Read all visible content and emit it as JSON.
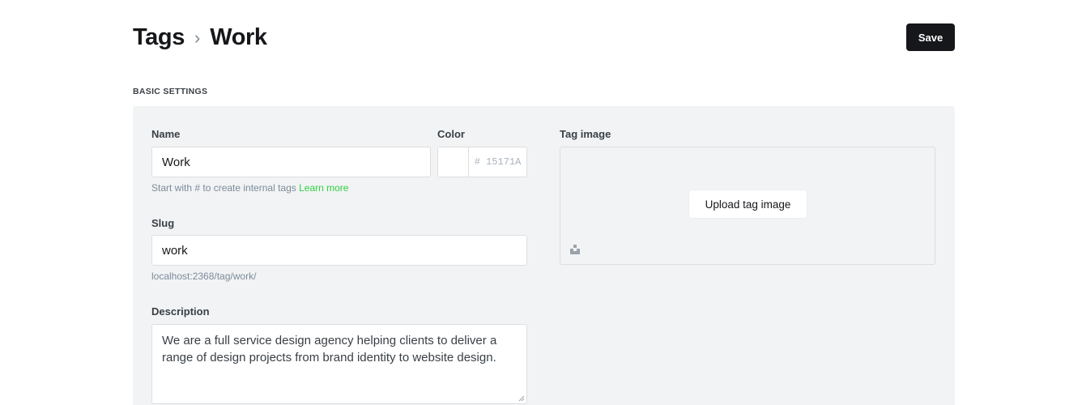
{
  "header": {
    "breadcrumb_parent": "Tags",
    "breadcrumb_separator": "›",
    "breadcrumb_current": "Work",
    "save_label": "Save"
  },
  "section": {
    "title": "BASIC SETTINGS"
  },
  "form": {
    "name": {
      "label": "Name",
      "value": "Work",
      "hint": "Start with # to create internal tags",
      "hint_link": "Learn more"
    },
    "color": {
      "label": "Color",
      "hex_placeholder": "# 15171A"
    },
    "slug": {
      "label": "Slug",
      "value": "work",
      "hint": "localhost:2368/tag/work/"
    },
    "description": {
      "label": "Description",
      "value": "We are a full service design agency helping clients to deliver a range of design projects from brand identity to website design."
    },
    "tag_image": {
      "label": "Tag image",
      "upload_label": "Upload tag image",
      "unsplash_icon": "unsplash-icon"
    }
  },
  "colors": {
    "primary_button": "#15171a",
    "panel_bg": "#f1f3f4",
    "link_green": "#30cf43",
    "hint_gray": "#7c8b9a"
  }
}
